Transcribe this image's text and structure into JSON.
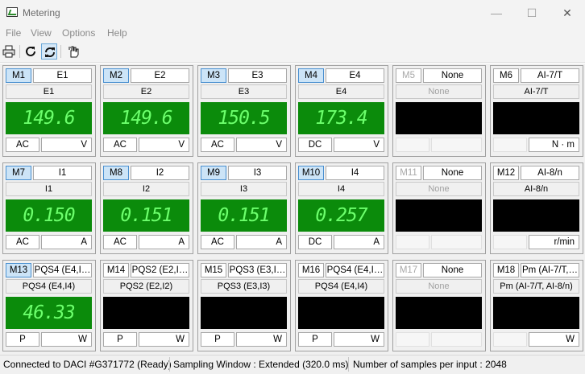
{
  "window": {
    "title": "Metering"
  },
  "window_controls": {
    "minimize": "—",
    "maximize": "☐",
    "close": "✕"
  },
  "menu": [
    {
      "label": "File"
    },
    {
      "label": "View"
    },
    {
      "label": "Options"
    },
    {
      "label": "Help"
    }
  ],
  "toolbar": [
    {
      "icon": "printer-icon"
    },
    {
      "icon": "refresh-icon"
    },
    {
      "icon": "auto-refresh-icon",
      "active": true
    },
    {
      "icon": "hand-pointer-icon"
    }
  ],
  "colors": {
    "display_on": "#0b8b0b",
    "display_off": "#000000",
    "digits": "#6cff6c",
    "selected_channel": "#cce4f7"
  },
  "channels": [
    {
      "channel": "M1",
      "selected": true,
      "enabled": true,
      "signal": "E1",
      "name": "E1",
      "value": "149.6",
      "mode": "AC",
      "unit": "V"
    },
    {
      "channel": "M2",
      "selected": true,
      "enabled": true,
      "signal": "E2",
      "name": "E2",
      "value": "149.6",
      "mode": "AC",
      "unit": "V"
    },
    {
      "channel": "M3",
      "selected": true,
      "enabled": true,
      "signal": "E3",
      "name": "E3",
      "value": "150.5",
      "mode": "AC",
      "unit": "V"
    },
    {
      "channel": "M4",
      "selected": true,
      "enabled": true,
      "signal": "E4",
      "name": "E4",
      "value": "173.4",
      "mode": "DC",
      "unit": "V"
    },
    {
      "channel": "M5",
      "selected": false,
      "enabled": false,
      "signal": "None",
      "name": "None",
      "value": "",
      "mode": "",
      "unit": ""
    },
    {
      "channel": "M6",
      "selected": false,
      "enabled": true,
      "signal": "AI-7/T",
      "name": "AI-7/T",
      "value": "",
      "mode": "",
      "unit": "N · m"
    },
    {
      "channel": "M7",
      "selected": true,
      "enabled": true,
      "signal": "I1",
      "name": "I1",
      "value": "0.150",
      "mode": "AC",
      "unit": "A"
    },
    {
      "channel": "M8",
      "selected": true,
      "enabled": true,
      "signal": "I2",
      "name": "I2",
      "value": "0.151",
      "mode": "AC",
      "unit": "A"
    },
    {
      "channel": "M9",
      "selected": true,
      "enabled": true,
      "signal": "I3",
      "name": "I3",
      "value": "0.151",
      "mode": "AC",
      "unit": "A"
    },
    {
      "channel": "M10",
      "selected": true,
      "enabled": true,
      "signal": "I4",
      "name": "I4",
      "value": "0.257",
      "mode": "DC",
      "unit": "A"
    },
    {
      "channel": "M11",
      "selected": false,
      "enabled": false,
      "signal": "None",
      "name": "None",
      "value": "",
      "mode": "",
      "unit": ""
    },
    {
      "channel": "M12",
      "selected": false,
      "enabled": true,
      "signal": "AI-8/n",
      "name": "AI-8/n",
      "value": "",
      "mode": "",
      "unit": "r/min"
    },
    {
      "channel": "M13",
      "selected": true,
      "enabled": true,
      "signal": "PQS4 (E4,I…",
      "name": "PQS4 (E4,I4)",
      "value": "46.33",
      "mode": "P",
      "unit": "W"
    },
    {
      "channel": "M14",
      "selected": false,
      "enabled": true,
      "signal": "PQS2 (E2,I…",
      "name": "PQS2 (E2,I2)",
      "value": "",
      "mode": "P",
      "unit": "W"
    },
    {
      "channel": "M15",
      "selected": false,
      "enabled": true,
      "signal": "PQS3 (E3,I…",
      "name": "PQS3 (E3,I3)",
      "value": "",
      "mode": "P",
      "unit": "W"
    },
    {
      "channel": "M16",
      "selected": false,
      "enabled": true,
      "signal": "PQS4 (E4,I…",
      "name": "PQS4 (E4,I4)",
      "value": "",
      "mode": "P",
      "unit": "W"
    },
    {
      "channel": "M17",
      "selected": false,
      "enabled": false,
      "signal": "None",
      "name": "None",
      "value": "",
      "mode": "",
      "unit": ""
    },
    {
      "channel": "M18",
      "selected": false,
      "enabled": true,
      "signal": "Pm (AI-7/T,…",
      "name": "Pm (AI-7/T, AI-8/n)",
      "value": "",
      "mode": "",
      "unit": "W"
    }
  ],
  "status": {
    "connection": "Connected to DACI #G371772  (Ready)",
    "sampling": "Sampling Window : Extended (320.0 ms)",
    "samples": "Number of samples per input : 2048"
  }
}
